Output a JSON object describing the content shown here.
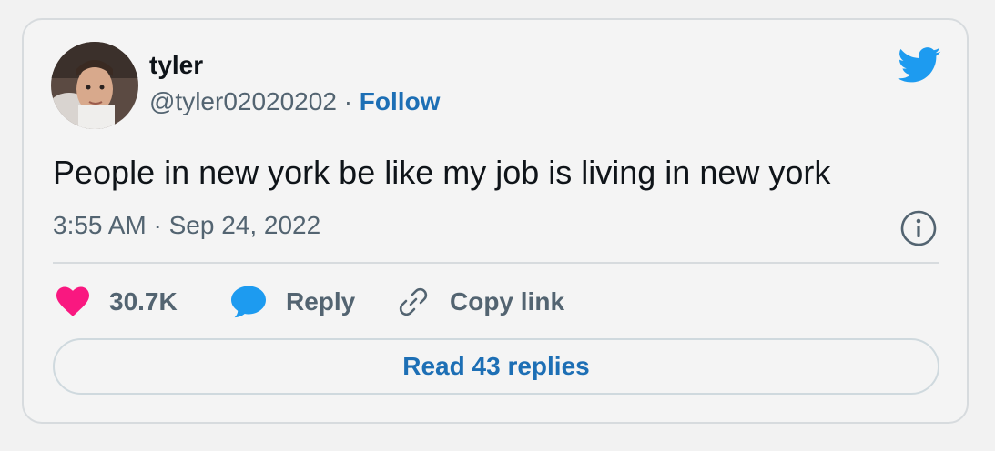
{
  "author": {
    "name": "tyler",
    "handle": "@tyler02020202",
    "separator": "·",
    "follow_label": "Follow",
    "avatar_icon": "profile-photo"
  },
  "tweet": {
    "text": "People in new york be like my job is living in new york",
    "timestamp": "3:55 AM · Sep 24, 2022"
  },
  "actions": {
    "likes_count": "30.7K",
    "reply_label": "Reply",
    "copy_link_label": "Copy link"
  },
  "read_replies_label": "Read 43 replies",
  "icons": {
    "brand": "twitter-bird-icon",
    "info": "info-icon",
    "like": "heart-icon",
    "reply": "speech-bubble-icon",
    "copy": "link-icon"
  },
  "colors": {
    "brand_blue": "#1d9bf0",
    "link_blue": "#1d6fb5",
    "like_pink": "#f91880",
    "text": "#0f1419",
    "muted": "#536471"
  }
}
